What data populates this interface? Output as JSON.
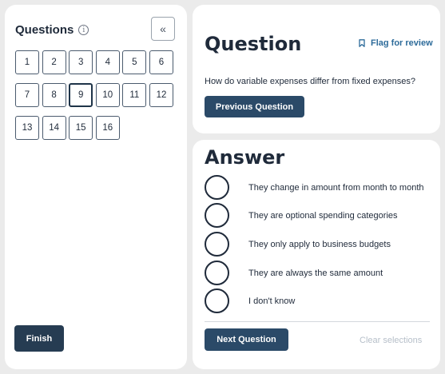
{
  "sidebar": {
    "title": "Questions",
    "info_glyph": "i",
    "collapse_glyph": "«",
    "questions": [
      "1",
      "2",
      "3",
      "4",
      "5",
      "6",
      "7",
      "8",
      "9",
      "10",
      "11",
      "12",
      "13",
      "14",
      "15",
      "16"
    ],
    "current_question": "9",
    "finish_label": "Finish"
  },
  "question": {
    "title": "Question",
    "flag_label": "Flag for review",
    "text": "How do variable expenses differ from fixed expenses?",
    "previous_label": "Previous Question"
  },
  "answer": {
    "title": "Answer",
    "options": [
      "They change in amount from month to month",
      "They are optional spending categories",
      "They only apply to business budgets",
      "They are always the same amount",
      "I don't know"
    ],
    "next_label": "Next Question",
    "clear_label": "Clear selections"
  },
  "colors": {
    "primary_button": "#2b4a68",
    "finish_button": "#263c52",
    "link": "#2d6b9a",
    "background": "#ebebeb"
  }
}
